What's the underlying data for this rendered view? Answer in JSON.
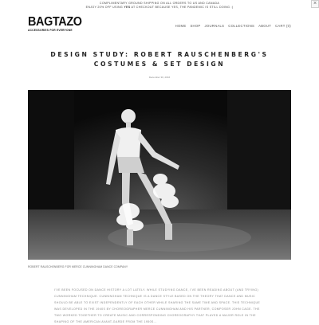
{
  "promo": {
    "line1": "Complimentary ground shipping on all orders to US and Canada",
    "line2_prefix": "Enjoy 20% off using ",
    "line2_code": "YES",
    "line2_suffix": " at checkout because yes, the pandemic is still doing :)"
  },
  "close_label": "×",
  "logo": {
    "wordmark": "BAGTAZO",
    "tagline": "Accessories for everyone"
  },
  "nav": {
    "items": [
      "Home",
      "Shop",
      "Journals",
      "Collections",
      "About",
      "Cart (0)"
    ]
  },
  "post": {
    "title": "Design Study: Robert Rauschenberg's Costumes & Set Design",
    "date": "December 30, 2016",
    "image_caption": "Robert Rauschenberg for Merce Cunningham Dance Company",
    "body": "I've been focused on dance history a lot lately. While studying dance, I've been reading about (and trying) Cunningham technique. Cunningham technique is a dance style based on the theory that dance and music should be able to exist independently of each other while sharing the same time and space. This technique was developed in the 1940s by choreographer Merce Cunningham and his partner, composer John Cage. The two worked together to create music and corresponding choreography that played a major role in the shaping of the American avant-garde from the 1950s..."
  }
}
